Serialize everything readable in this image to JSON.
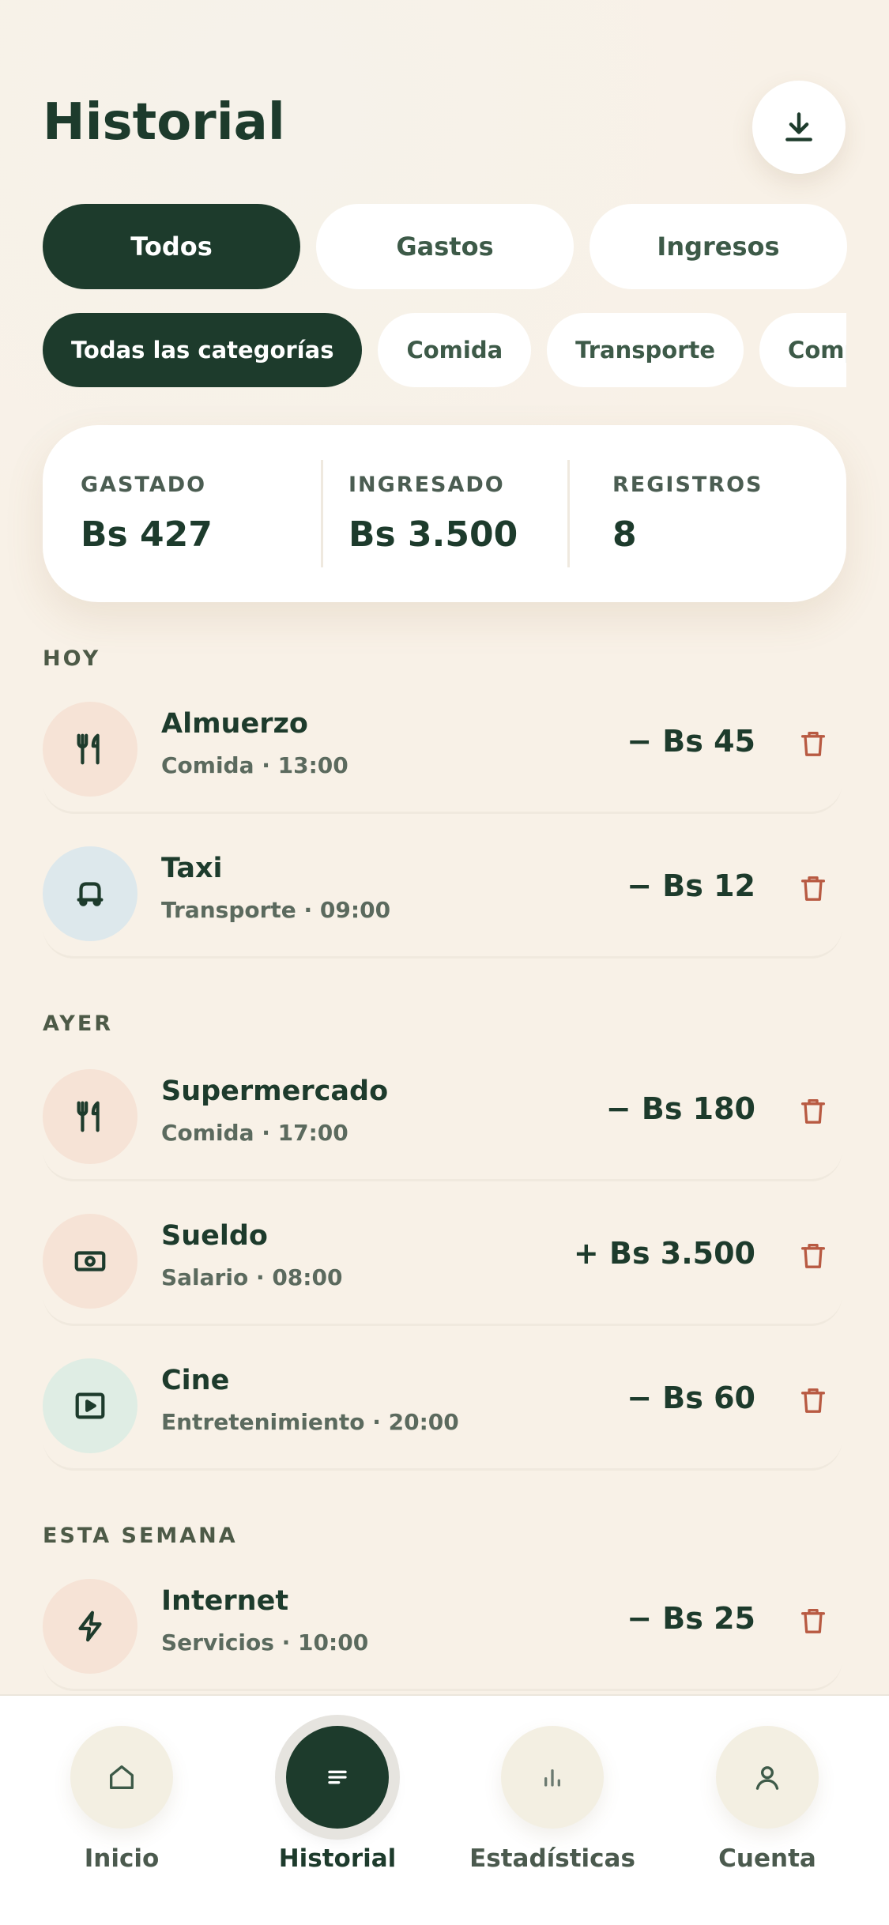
{
  "header": {
    "title": "Historial",
    "download_icon": "download-icon"
  },
  "type_filters": [
    {
      "label": "Todos",
      "active": true
    },
    {
      "label": "Gastos",
      "active": false
    },
    {
      "label": "Ingresos",
      "active": false
    }
  ],
  "category_filters": [
    {
      "label": "Todas las categorías",
      "active": true
    },
    {
      "label": "Comida",
      "active": false
    },
    {
      "label": "Transporte",
      "active": false
    },
    {
      "label": "Compras",
      "active": false
    }
  ],
  "summary": {
    "spent_label": "GASTADO",
    "spent_value": "Bs 427",
    "income_label": "INGRESADO",
    "income_value": "Bs 3.500",
    "records_label": "REGISTROS",
    "records_value": "8"
  },
  "sections": [
    {
      "label": "HOY",
      "items": [
        {
          "name": "Almuerzo",
          "meta": "Comida · 13:00",
          "amount": "− Bs 45",
          "icon": "utensils-icon",
          "icon_bg": "#f6e3d6"
        },
        {
          "name": "Taxi",
          "meta": "Transporte · 09:00",
          "amount": "− Bs 12",
          "icon": "car-icon",
          "icon_bg": "#dde8ec"
        }
      ]
    },
    {
      "label": "AYER",
      "items": [
        {
          "name": "Supermercado",
          "meta": "Comida · 17:00",
          "amount": "− Bs 180",
          "icon": "utensils-icon",
          "icon_bg": "#f6e3d6"
        },
        {
          "name": "Sueldo",
          "meta": "Salario · 08:00",
          "amount": "+ Bs 3.500",
          "icon": "banknote-icon",
          "icon_bg": "#f6e3d6"
        },
        {
          "name": "Cine",
          "meta": "Entretenimiento · 20:00",
          "amount": "− Bs 60",
          "icon": "play-icon",
          "icon_bg": "#dfede4"
        }
      ]
    },
    {
      "label": "ESTA SEMANA",
      "items": [
        {
          "name": "Internet",
          "meta": "Servicios · 10:00",
          "amount": "− Bs 25",
          "icon": "bolt-icon",
          "icon_bg": "#f6e3d6"
        }
      ]
    }
  ],
  "nav": [
    {
      "label": "Inicio",
      "icon": "home-icon",
      "active": false
    },
    {
      "label": "Historial",
      "icon": "list-icon",
      "active": true
    },
    {
      "label": "Estadísticas",
      "icon": "bar-chart-icon",
      "active": false
    },
    {
      "label": "Cuenta",
      "icon": "user-icon",
      "active": false
    }
  ],
  "colors": {
    "primary": "#1d3b2c",
    "delete": "#b85a42",
    "background": "#f8f1e7"
  }
}
